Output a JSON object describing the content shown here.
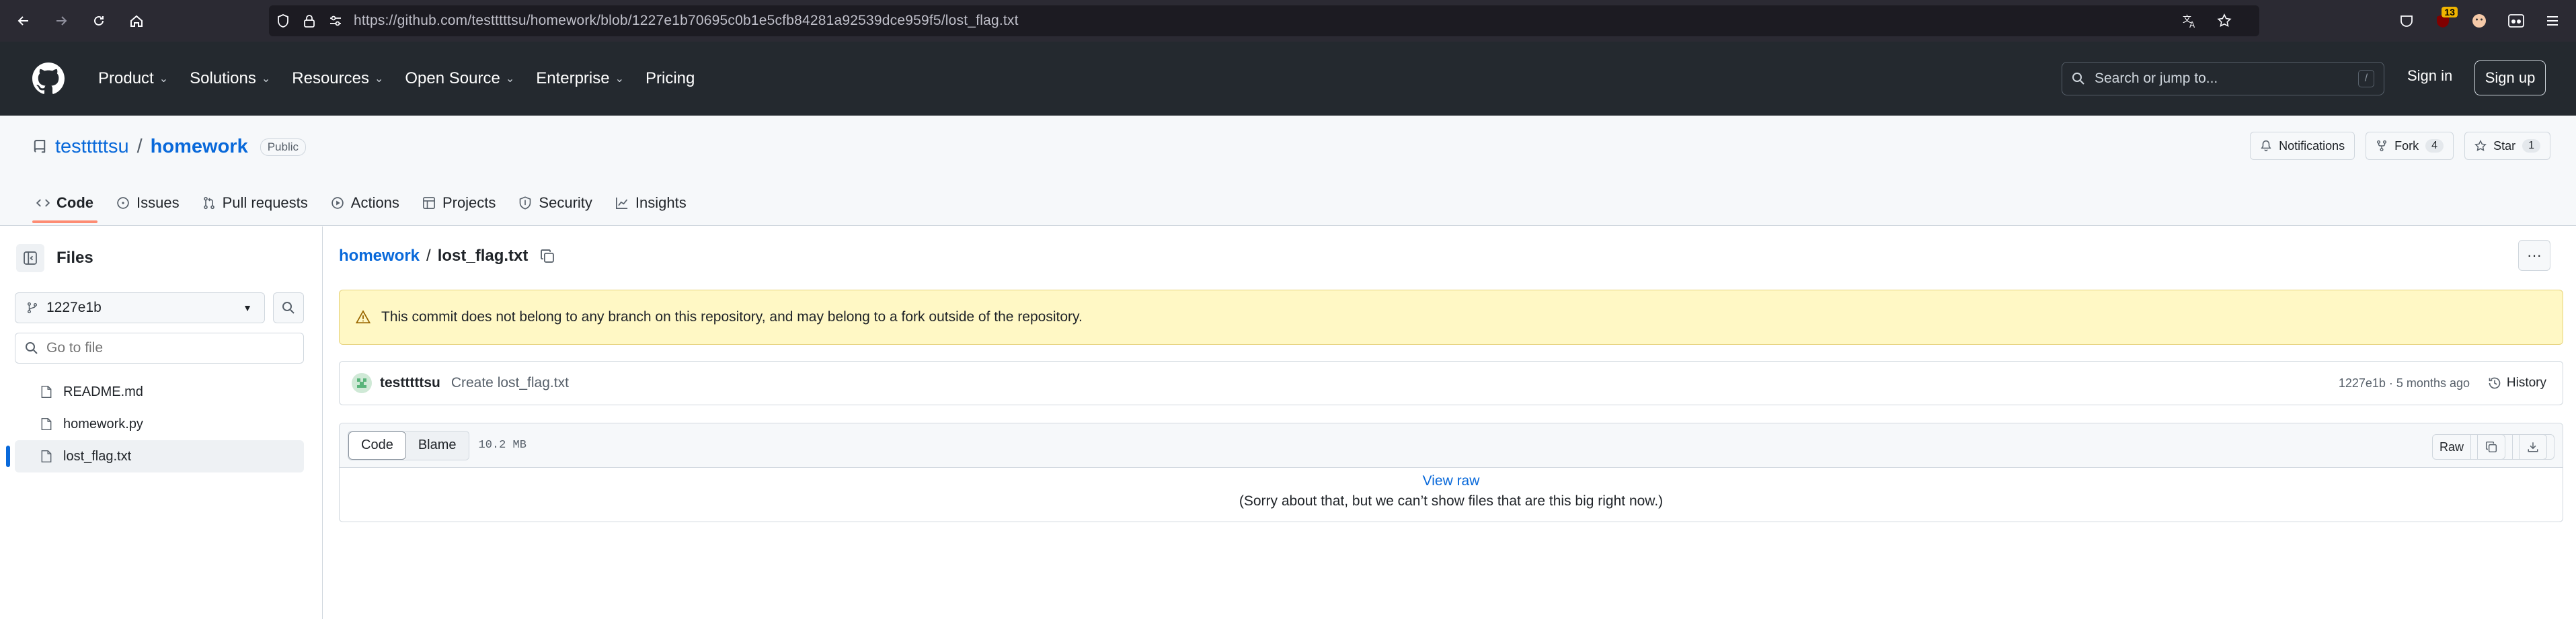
{
  "browser": {
    "url": "https://github.com/testttttsu/homework/blob/1227e1b70695c0b1e5cfb84281a92539dce959f5/lost_flag.txt",
    "extension_badge": "13"
  },
  "header": {
    "nav": [
      {
        "label": "Product"
      },
      {
        "label": "Solutions"
      },
      {
        "label": "Resources"
      },
      {
        "label": "Open Source"
      },
      {
        "label": "Enterprise"
      },
      {
        "label": "Pricing"
      }
    ],
    "search_placeholder": "Search or jump to...",
    "search_shortcut": "/",
    "signin": "Sign in",
    "signup": "Sign up"
  },
  "repo": {
    "owner": "testttttsu",
    "separator": "/",
    "name": "homework",
    "visibility": "Public",
    "notifications": "Notifications",
    "fork_label": "Fork",
    "fork_count": "4",
    "star_label": "Star",
    "star_count": "1",
    "tabs": [
      {
        "label": "Code"
      },
      {
        "label": "Issues"
      },
      {
        "label": "Pull requests"
      },
      {
        "label": "Actions"
      },
      {
        "label": "Projects"
      },
      {
        "label": "Security"
      },
      {
        "label": "Insights"
      }
    ]
  },
  "sidebar": {
    "title": "Files",
    "branch": "1227e1b",
    "goto_placeholder": "Go to file",
    "files": [
      {
        "name": "README.md"
      },
      {
        "name": "homework.py"
      },
      {
        "name": "lost_flag.txt"
      }
    ]
  },
  "main": {
    "crumb_repo": "homework",
    "crumb_sep": "/",
    "crumb_file": "lost_flag.txt",
    "flash": "This commit does not belong to any branch on this repository, and may belong to a fork outside of the repository.",
    "commit": {
      "author": "testttttsu",
      "message": "Create lost_flag.txt",
      "meta": "1227e1b · 5 months ago",
      "history": "History"
    },
    "viewer": {
      "code_tab": "Code",
      "blame_tab": "Blame",
      "size": "10.2 MB",
      "raw_button": "Raw",
      "view_raw": "View raw",
      "too_big": "(Sorry about that, but we can’t show files that are this big right now.)"
    }
  },
  "colors": {
    "accent": "#0969da",
    "header_bg": "#24292f",
    "browser_bg": "#2b2a33",
    "flash_bg": "#fff8c5",
    "active_tab_underline": "#fd8c73"
  }
}
